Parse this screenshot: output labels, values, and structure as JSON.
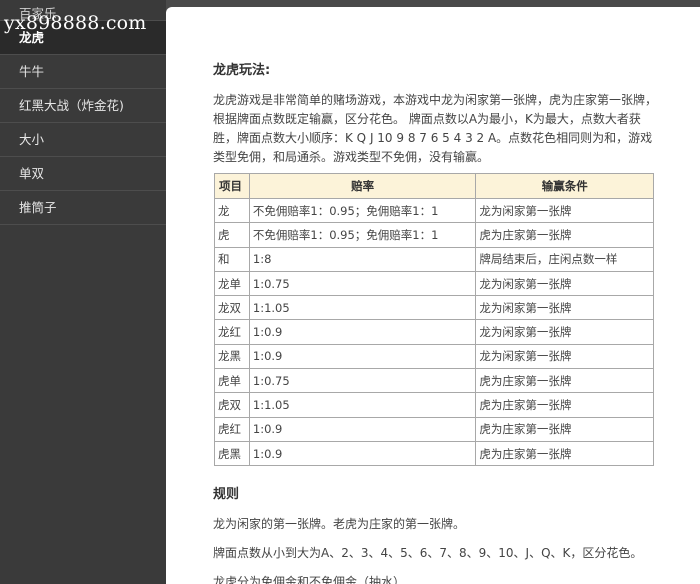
{
  "watermark": "yx898888.com",
  "sidebar": {
    "items": [
      {
        "label": "百家乐",
        "active": false
      },
      {
        "label": "龙虎",
        "active": true
      },
      {
        "label": "牛牛",
        "active": false
      },
      {
        "label": "红黑大战（炸金花)",
        "active": false
      },
      {
        "label": "大小",
        "active": false
      },
      {
        "label": "单双",
        "active": false
      },
      {
        "label": "推筒子",
        "active": false
      }
    ]
  },
  "main": {
    "title": "龙虎玩法:",
    "intro": "龙虎游戏是非常简单的赌场游戏，本游戏中龙为闲家第一张牌，虎为庄家第一张牌，根据牌面点数既定输赢，区分花色。 牌面点数以A为最小，K为最大，点数大者获胜，牌面点数大小顺序：K Q J 10 9 8 7 6 5 4 3 2 A。点数花色相同则为和，游戏类型免佣，和局通杀。游戏类型不免佣，没有输赢。",
    "table": {
      "headers": [
        "项目",
        "赔率",
        "输赢条件"
      ],
      "rows": [
        [
          "龙",
          "不免佣赔率1：0.95；免佣赔率1：1",
          "龙为闲家第一张牌"
        ],
        [
          "虎",
          "不免佣赔率1：0.95；免佣赔率1：1",
          "虎为庄家第一张牌"
        ],
        [
          "和",
          "1:8",
          "牌局结束后，庄闲点数一样"
        ],
        [
          "龙单",
          "1:0.75",
          "龙为闲家第一张牌"
        ],
        [
          "龙双",
          "1:1.05",
          "龙为闲家第一张牌"
        ],
        [
          "龙红",
          "1:0.9",
          "龙为闲家第一张牌"
        ],
        [
          "龙黑",
          "1:0.9",
          "龙为闲家第一张牌"
        ],
        [
          "虎单",
          "1:0.75",
          "虎为庄家第一张牌"
        ],
        [
          "虎双",
          "1:1.05",
          "虎为庄家第一张牌"
        ],
        [
          "虎红",
          "1:0.9",
          "虎为庄家第一张牌"
        ],
        [
          "虎黑",
          "1:0.9",
          "虎为庄家第一张牌"
        ]
      ]
    },
    "rules_title": "规则",
    "rules": [
      "龙为闲家的第一张牌。老虎为庄家的第一张牌。",
      "牌面点数从小到大为A、2、3、4、5、6、7、8、9、10、J、Q、K，区分花色。",
      "龙虎分为免佣金和不免佣金（抽水）"
    ]
  }
}
